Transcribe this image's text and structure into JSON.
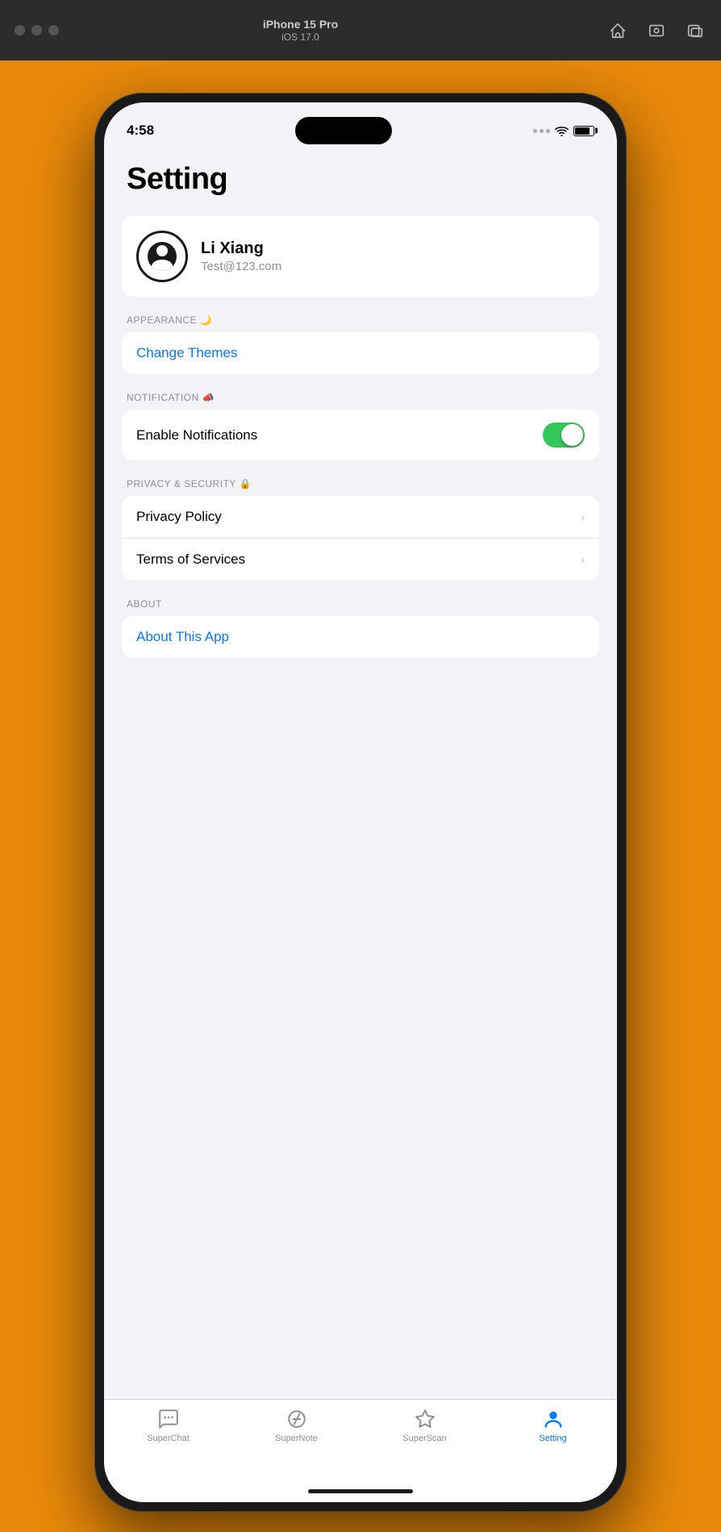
{
  "mac_toolbar": {
    "model": "iPhone 15 Pro",
    "ios": "iOS 17.0",
    "icons": [
      "home",
      "screenshot",
      "window"
    ]
  },
  "status_bar": {
    "time": "4:58"
  },
  "page": {
    "title": "Setting"
  },
  "user": {
    "name": "Li Xiang",
    "email": "Test@123.com"
  },
  "sections": {
    "appearance": {
      "label": "APPEARANCE 🌙",
      "items": [
        {
          "text": "Change Themes",
          "type": "blue-link"
        }
      ]
    },
    "notification": {
      "label": "NOTIFICATION 📣",
      "items": [
        {
          "text": "Enable Notifications",
          "type": "toggle",
          "enabled": true
        }
      ]
    },
    "privacy": {
      "label": "PRIVACY & SECURITY 🔒",
      "items": [
        {
          "text": "Privacy Policy",
          "type": "chevron"
        },
        {
          "text": "Terms of Services",
          "type": "chevron"
        }
      ]
    },
    "about": {
      "label": "ABOUT",
      "items": [
        {
          "text": "About This App",
          "type": "blue-link"
        }
      ]
    }
  },
  "tab_bar": {
    "items": [
      {
        "label": "SuperChat",
        "icon": "chat",
        "active": false
      },
      {
        "label": "SuperNote",
        "icon": "note",
        "active": false
      },
      {
        "label": "SuperScan",
        "icon": "scan",
        "active": false
      },
      {
        "label": "Setting",
        "icon": "person",
        "active": true
      }
    ]
  },
  "colors": {
    "accent": "#007aff",
    "toggle_on": "#34c759",
    "active_tab": "#007aff",
    "inactive_tab": "#8e8e93"
  }
}
